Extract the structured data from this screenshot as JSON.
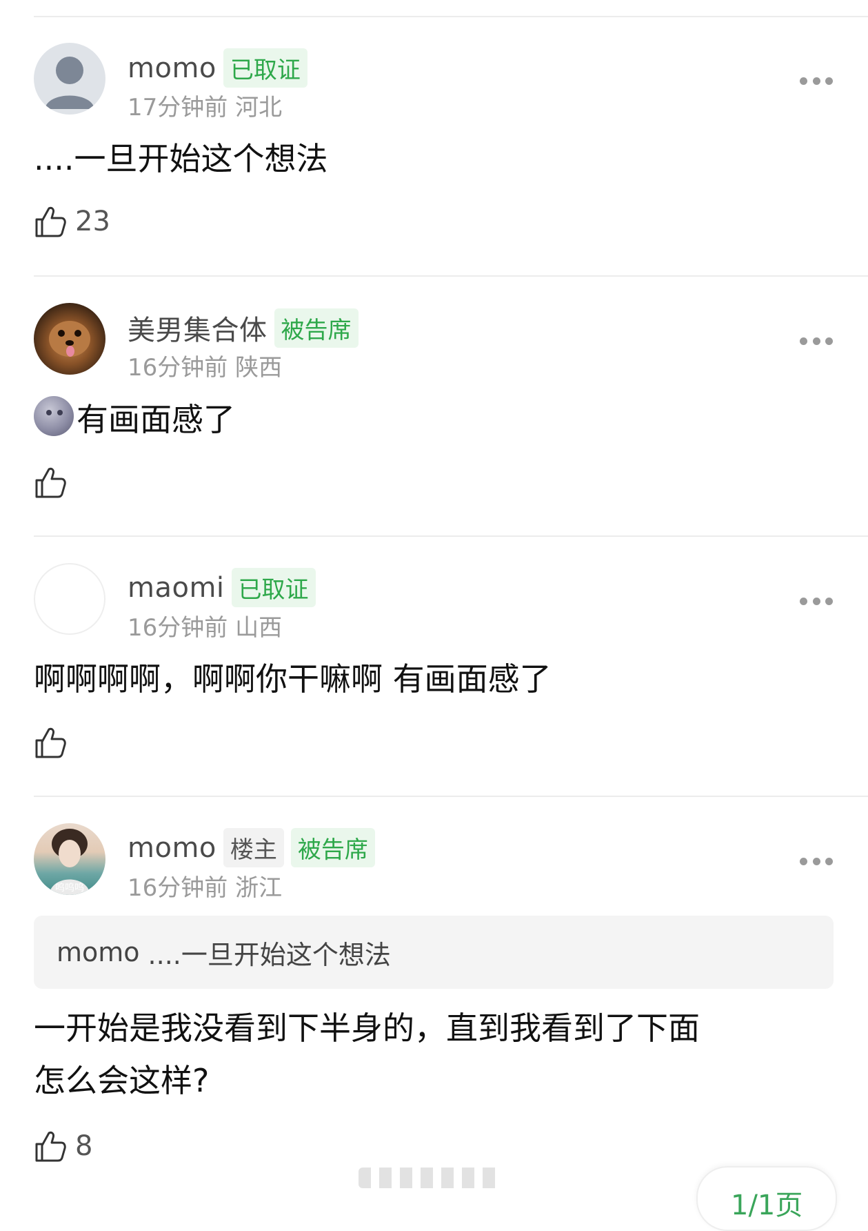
{
  "comments": [
    {
      "user": "momo",
      "badges": [
        "已取证"
      ],
      "time": "17分钟前",
      "location": "河北",
      "text": "....一旦开始这个想法",
      "likes": "23"
    },
    {
      "user": "美男集合体",
      "badges": [
        "被告席"
      ],
      "time": "16分钟前",
      "location": "陕西",
      "text": "有画面感了",
      "likes": ""
    },
    {
      "user": "maomi",
      "badges": [
        "已取证"
      ],
      "time": "16分钟前",
      "location": "山西",
      "text": "啊啊啊啊，啊啊你干嘛啊 有画面感了",
      "likes": ""
    },
    {
      "user": "momo",
      "badges": [
        "楼主",
        "被告席"
      ],
      "time": "16分钟前",
      "location": "浙江",
      "quote_user": "momo",
      "quote_text": "....一旦开始这个想法",
      "text_line1": "一开始是我没看到下半身的，直到我看到了下面",
      "text_line2": "怎么会这样?",
      "likes": "8",
      "avatar_caption": "呜呜呜"
    }
  ],
  "pagination": {
    "label": "1/1页"
  },
  "colors": {
    "badge_green": "#2ea84a",
    "meta_gray": "#9a9a9a"
  },
  "icons": {
    "like": "thumbs-up-icon",
    "more": "more-dots-icon"
  }
}
